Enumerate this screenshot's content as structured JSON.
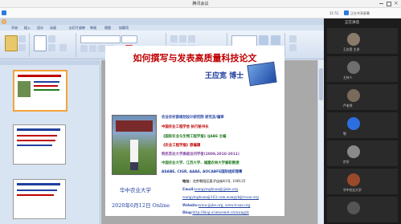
{
  "meeting": {
    "window_title": "腾讯会议",
    "time": "31:51",
    "share_status": "正在共享屏幕",
    "members_title": "正在讲话"
  },
  "ppt": {
    "title_text": "",
    "tabs": [
      "开始",
      "插入",
      "设计",
      "动画",
      "幻灯片放映",
      "审阅",
      "视图",
      "加载项"
    ]
  },
  "slide": {
    "title": "如何撰写与发表高质量科技论文",
    "author": "王应宽  博士",
    "affiliations": [
      {
        "text": "农业农村部规划设计研究院  研究员/编审",
        "color": "#1f3f9f"
      },
      {
        "text": "中国农业工程学会  执行秘书长",
        "color": "#c00000"
      },
      {
        "text": "《国际农业与生物工程学报》IJABE 主编",
        "color": "#1f7a1f"
      },
      {
        "text": "《农业工程学报》原编辑",
        "color": "#c00000"
      },
      {
        "text": "明尼苏达大学高级访问学者(2009,2010-2011)",
        "color": "#7f3f9f"
      },
      {
        "text": "中国农业大学、江苏大学、福建农林大学兼职教授",
        "color": "#1f7a1f"
      },
      {
        "text": "ASABE, CIGR, AAAE, AOCABFE国际组织理事",
        "color": "#1f3f9f"
      }
    ],
    "university": "华中农业大学",
    "date": "2020年6月12日 Online",
    "contacts": [
      {
        "label": "地址：",
        "text": "北京朝阳区麦子店街41号, 100125",
        "color": "#000000"
      },
      {
        "label": "Email:",
        "text": "wangyingkuan@ijabe.org",
        "color": "#1f3f9f"
      },
      {
        "label": "",
        "text": "wangyingkuan@163.com,wangyk@tcsae.org",
        "color": "#1f3f9f"
      },
      {
        "label": "Website:",
        "text": "www.ijabe.org, www.tcsae.org",
        "color": "#1f3f9f"
      },
      {
        "label": "Blog:",
        "text": "http://blog.sciencenet.cn/wangyk",
        "color": "#1f3f9f"
      }
    ]
  },
  "participants": [
    {
      "name": "王应宽 主讲",
      "color": "#8a7a6a"
    },
    {
      "name": "主持人",
      "color": "#6e6e6e"
    },
    {
      "name": "严老师",
      "color": "#7a6a5a"
    },
    {
      "name": "鄂",
      "color": "#2d6fe0"
    },
    {
      "name": "宗学",
      "color": "#8a8a8a"
    },
    {
      "name": "华中农业大学",
      "color": "#9a4a2a"
    },
    {
      "name": "",
      "color": "#555555"
    }
  ]
}
